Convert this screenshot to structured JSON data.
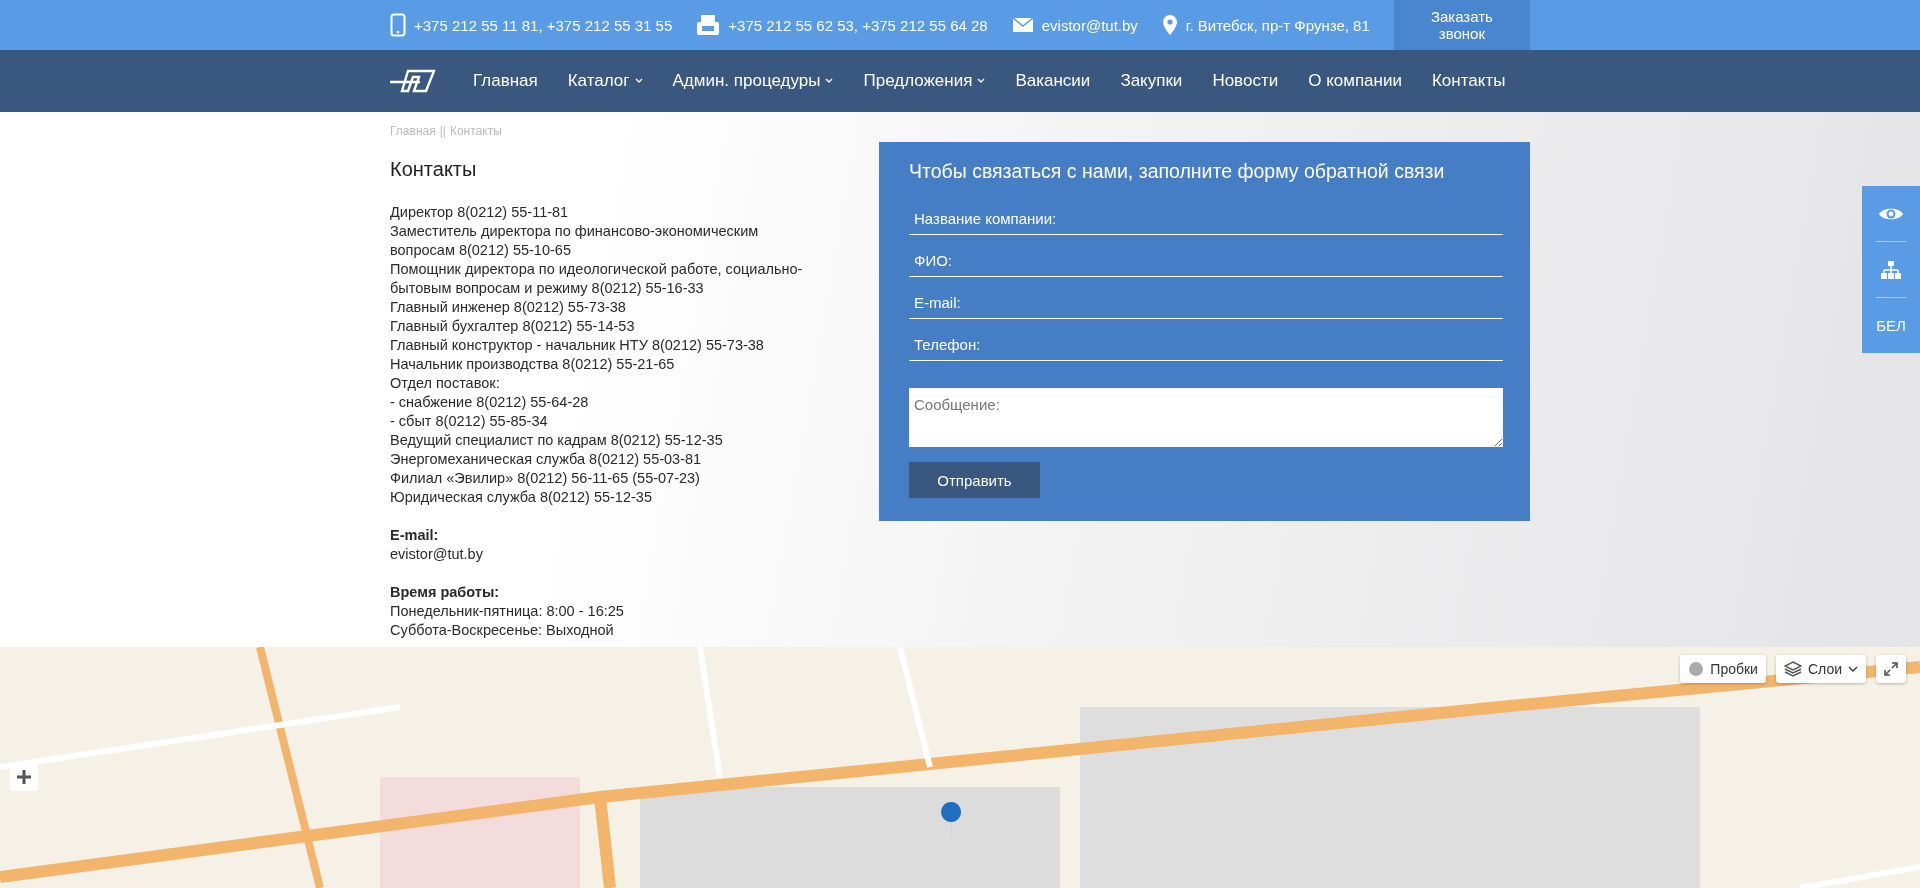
{
  "top_bar": {
    "contacts": [
      {
        "kind": "phone",
        "text": "+375 212 55 11 81, +375 212 55 31 55"
      },
      {
        "kind": "fax",
        "text": "+375 212 55 62 53, +375 212 55 64 28"
      },
      {
        "kind": "email",
        "text": "evistor@tut.by"
      },
      {
        "kind": "location",
        "text": "г. Витебск, пр-т Фрунзе, 81"
      }
    ],
    "callback_button": "Заказать звонок"
  },
  "nav": {
    "items": [
      {
        "label": "Главная",
        "dropdown": false
      },
      {
        "label": "Каталог",
        "dropdown": true
      },
      {
        "label": "Админ. процедуры",
        "dropdown": true
      },
      {
        "label": "Предложения",
        "dropdown": true
      },
      {
        "label": "Вакансии",
        "dropdown": false
      },
      {
        "label": "Закупки",
        "dropdown": false
      },
      {
        "label": "Новости",
        "dropdown": false
      },
      {
        "label": "О компании",
        "dropdown": false
      },
      {
        "label": "Контакты",
        "dropdown": false
      }
    ]
  },
  "breadcrumb": [
    "Главная",
    "Контакты"
  ],
  "breadcrumb_separator": "||",
  "contacts": {
    "title": "Контакты",
    "lines": [
      "Директор 8(0212) 55-11-81",
      "Заместитель директора по финансово-экономическим вопросам 8(0212) 55-10-65",
      "Помощник директора по идеологической работе, социально-бытовым вопросам и режиму 8(0212) 55-16-33",
      "Главный инженер 8(0212) 55-73-38",
      "Главный бухгалтер 8(0212) 55-14-53",
      "Главный конструктор - начальник НТУ 8(0212) 55-73-38",
      "Начальник производства 8(0212) 55-21-65",
      "Отдел поставок:",
      "- снабжение 8(0212) 55-64-28",
      "- сбыт 8(0212) 55-85-34",
      "Ведущий специалист по кадрам 8(0212) 55-12-35",
      "Энергомеханическая служба 8(0212) 55-03-81",
      "Филиал «Эвилир» 8(0212) 56-11-65 (55-07-23)",
      "Юридическая служба 8(0212) 55-12-35"
    ],
    "email_label": "E-mail:",
    "email": "evistor@tut.by",
    "hours_label": "Время работы:",
    "hours": [
      "Понедельник-пятница: 8:00 - 16:25",
      "Суббота-Воскресенье: Выходной"
    ]
  },
  "form": {
    "title": "Чтобы связаться с нами, заполните форму обратной связи",
    "fields": [
      {
        "placeholder": "Название компании:"
      },
      {
        "placeholder": "ФИО:"
      },
      {
        "placeholder": "E-mail:"
      },
      {
        "placeholder": "Телефон:"
      }
    ],
    "message_placeholder": "Сообщение:",
    "submit": "Отправить"
  },
  "side_panel": {
    "language": "БЕЛ"
  },
  "map": {
    "traffic_button": "Пробки",
    "layers_button": "Слои"
  }
}
